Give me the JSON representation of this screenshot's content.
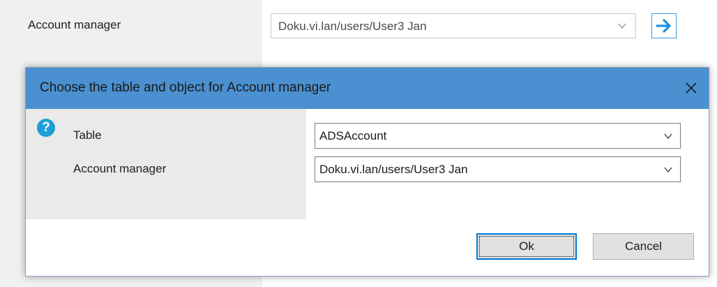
{
  "form": {
    "account_manager_label": "Account manager",
    "account_manager_value": "Doku.vi.lan/users/User3 Jan"
  },
  "dialog": {
    "title": "Choose the table and object for Account manager",
    "fields": [
      {
        "label": "Table",
        "value": "ADSAccount"
      },
      {
        "label": "Account manager",
        "value": "Doku.vi.lan/users/User3 Jan"
      }
    ],
    "ok_label": "Ok",
    "cancel_label": "Cancel"
  },
  "icons": {
    "help": "question-circle-icon",
    "close": "close-icon",
    "go": "arrow-right-icon",
    "dropdown": "chevron-down-icon"
  },
  "colors": {
    "titlebar": "#4b90d0",
    "accent": "#1e9ed8",
    "focus_border": "#0078d7"
  }
}
